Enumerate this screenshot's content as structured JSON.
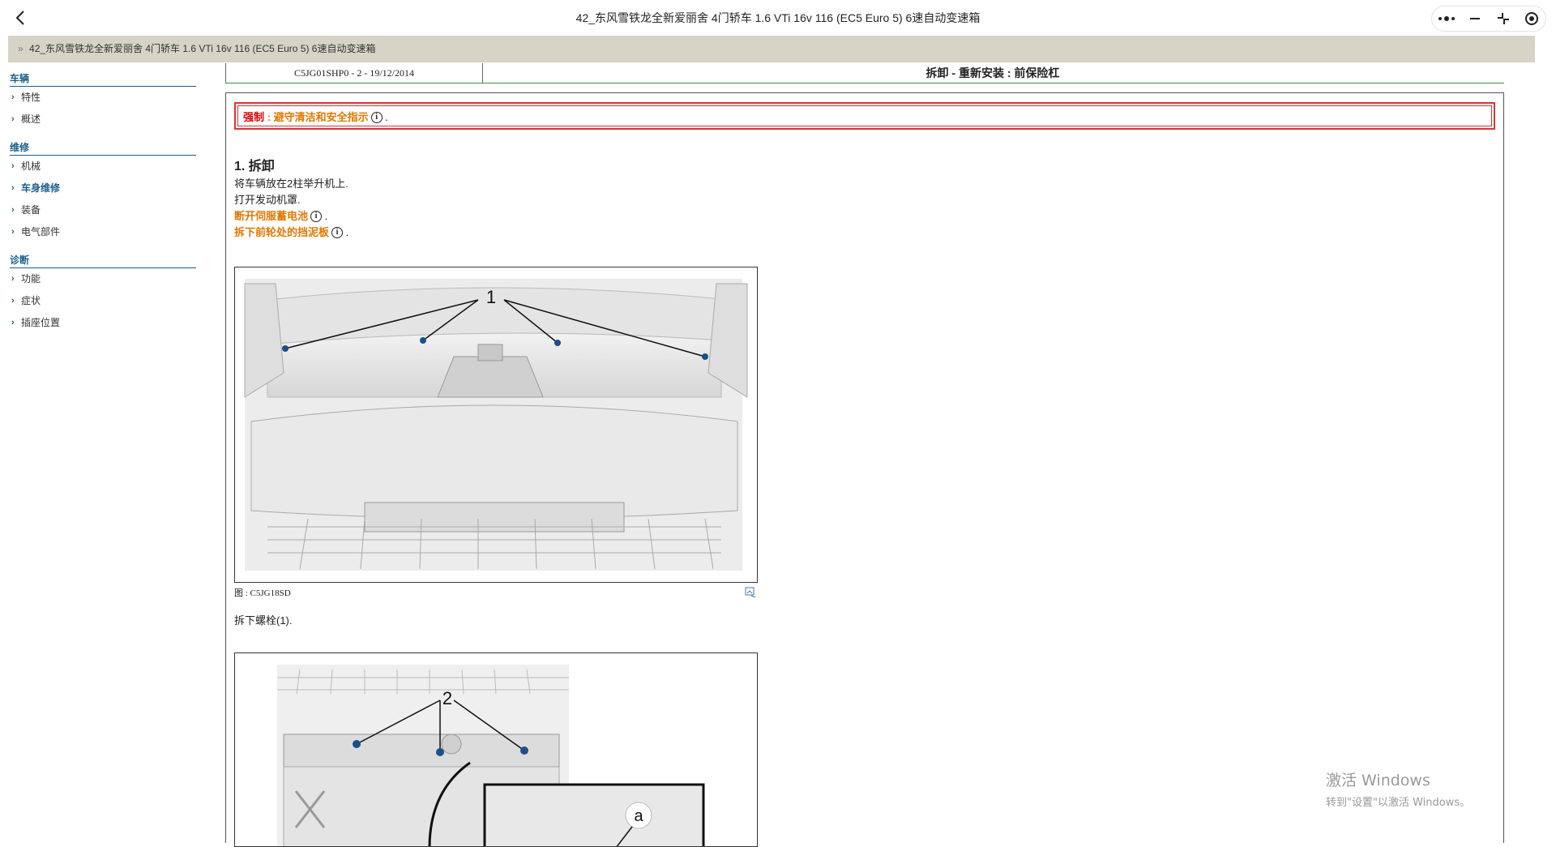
{
  "window": {
    "title": "42_东风雪铁龙全新爱丽舍 4门轿车 1.6 VTi 16v 116 (EC5 Euro 5) 6速自动变速箱"
  },
  "breadcrumb": {
    "arrow": "»",
    "text": "42_东风雪铁龙全新爱丽舍 4门轿车 1.6 VTi 16v 116 (EC5 Euro 5) 6速自动变速箱"
  },
  "sidebar": {
    "sections": [
      {
        "title": "车辆",
        "items": [
          "特性",
          "概述"
        ]
      },
      {
        "title": "维修",
        "items": [
          "机械",
          "车身维修",
          "装备",
          "电气部件"
        ],
        "active": "车身维修"
      },
      {
        "title": "诊断",
        "items": [
          "功能",
          "症状",
          "插座位置"
        ]
      }
    ]
  },
  "doc": {
    "code": "C5JG01SHP0 - 2 - 19/12/2014",
    "heading": "拆卸 - 重新安装 : 前保险杠"
  },
  "warning": {
    "label": "强制",
    "separator": " : ",
    "link": "避守清洁和安全指示",
    "suffix": " ."
  },
  "step1": {
    "title": "1. 拆卸",
    "line1": "将车辆放在2柱举升机上.",
    "line2": "打开发动机罩.",
    "link1": "断开伺服蓄电池",
    "link1_suffix": " .",
    "link2": "拆下前轮处的挡泥板",
    "link2_suffix": " .",
    "info_glyph": "i"
  },
  "figure1": {
    "caption": "图 : C5JG18SD",
    "callout": "1"
  },
  "step_note": "拆下螺栓(1).",
  "figure2": {
    "callout": "2",
    "detail_callout": "a"
  },
  "watermark": {
    "line1": "激活 Windows",
    "line2": "转到\"设置\"以激活 Windows。"
  },
  "colors": {
    "breadcrumb_bg": "#d7d3c6",
    "section_blue": "#1b5e8c",
    "warning_red": "#dd3333",
    "link_orange": "#e07800"
  }
}
